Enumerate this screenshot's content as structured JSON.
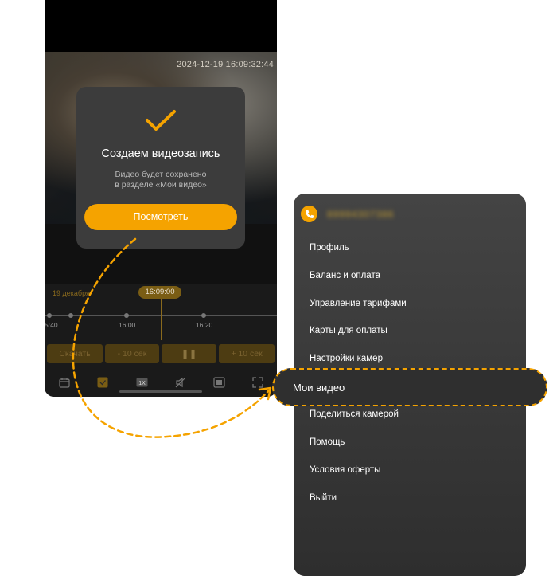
{
  "phone": {
    "video_timestamp": "2024-12-19 16:09:32:44",
    "timeline": {
      "date_label": "19 декабря",
      "current_time": "16:09:00",
      "tick_labels": [
        "5:40",
        "16:00",
        "16:20"
      ]
    },
    "controls": {
      "download_label": "Скачать",
      "back_label": "- 10 сек",
      "pause_label": "❚❚",
      "forward_label": "+ 10 сек"
    },
    "toolbar": {
      "speed_label": "1X"
    }
  },
  "overlay": {
    "title": "Создаем видеозапись",
    "subtitle_line1": "Видео будет сохранено",
    "subtitle_line2": "в разделе «Мои видео»",
    "button_label": "Посмотреть"
  },
  "menu": {
    "phone_number": "89994307386",
    "items": [
      {
        "label": "Профиль"
      },
      {
        "label": "Баланс и оплата"
      },
      {
        "label": "Управление тарифами"
      },
      {
        "label": "Карты для оплаты"
      },
      {
        "label": "Настройки камер"
      },
      {
        "label": "Мои видео"
      },
      {
        "label": "Поделиться камерой"
      },
      {
        "label": "Помощь"
      },
      {
        "label": "Условия оферты"
      },
      {
        "label": "Выйти"
      }
    ]
  },
  "colors": {
    "accent": "#f5a300",
    "menu_background": "#3a3a3a",
    "card_background": "#3c3c3c"
  }
}
